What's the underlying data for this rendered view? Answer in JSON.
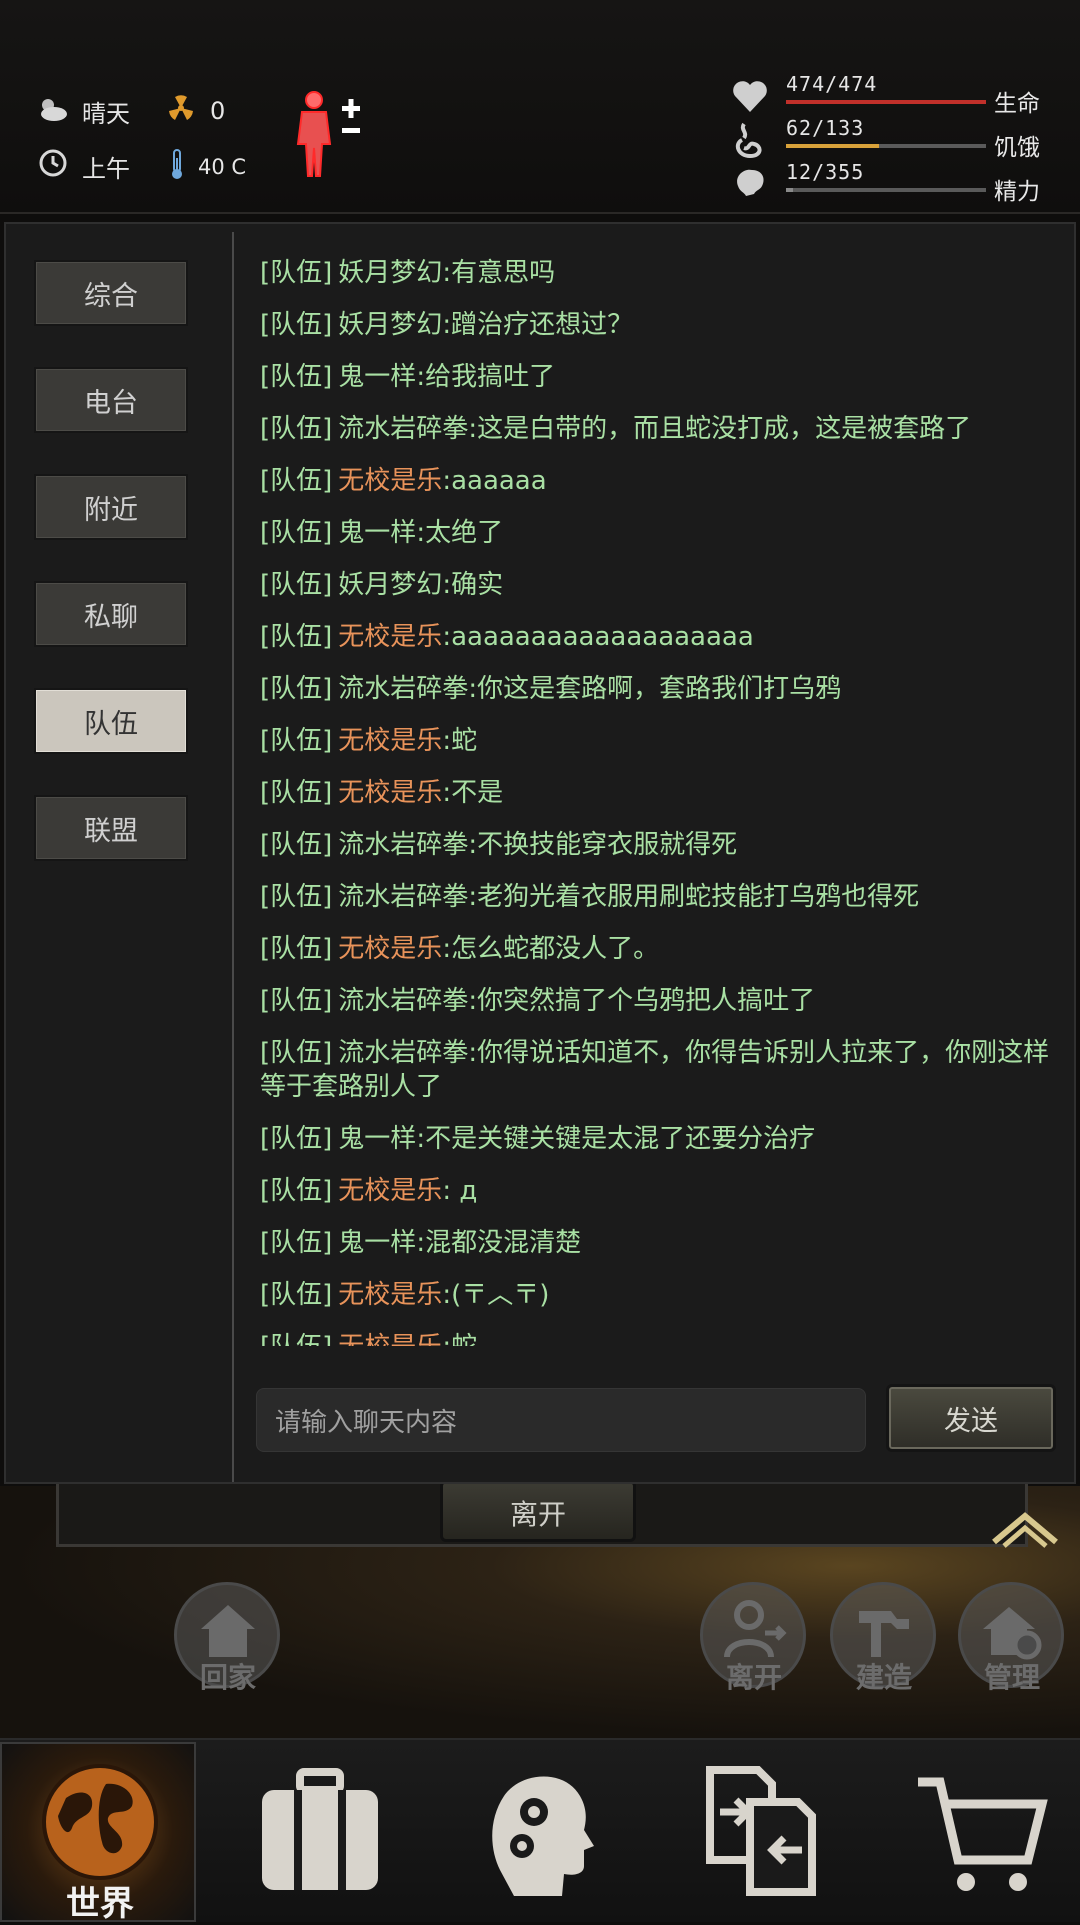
{
  "status": {
    "weather": "晴天",
    "radiation": "0",
    "time_of_day": "上午",
    "temperature": "40 C"
  },
  "bars": {
    "life": {
      "value": "474/474",
      "label": "生命",
      "fraction": 1.0,
      "color": "#c0302a"
    },
    "hunger": {
      "value": "62/133",
      "label": "饥饿",
      "fraction": 0.466,
      "color": "#d9a23a"
    },
    "energy": {
      "value": "12/355",
      "label": "精力",
      "fraction": 0.034,
      "color": "#8a8a8a"
    }
  },
  "channels": [
    {
      "label": "综合",
      "active": false
    },
    {
      "label": "电台",
      "active": false
    },
    {
      "label": "附近",
      "active": false
    },
    {
      "label": "私聊",
      "active": false
    },
    {
      "label": "队伍",
      "active": true
    },
    {
      "label": "联盟",
      "active": false
    }
  ],
  "messages": [
    {
      "channel": "[队伍]",
      "sender": "妖月梦幻",
      "text": ":有意思吗",
      "self": false
    },
    {
      "channel": "[队伍]",
      "sender": "妖月梦幻",
      "text": ":蹭治疗还想过？",
      "self": false
    },
    {
      "channel": "[队伍]",
      "sender": "鬼一样",
      "text": ":给我搞吐了",
      "self": false
    },
    {
      "channel": "[队伍]",
      "sender": "流水岩碎拳",
      "text": ":这是白带的，而且蛇没打成，这是被套路了",
      "self": false
    },
    {
      "channel": "[队伍]",
      "sender": "无校是乐",
      "text": ":aaaaaa",
      "self": true
    },
    {
      "channel": "[队伍]",
      "sender": "鬼一样",
      "text": ":太绝了",
      "self": false
    },
    {
      "channel": "[队伍]",
      "sender": "妖月梦幻",
      "text": ":确实",
      "self": false
    },
    {
      "channel": "[队伍]",
      "sender": "无校是乐",
      "text": ":aaaaaaaaaaaaaaaaaaa",
      "self": true
    },
    {
      "channel": "[队伍]",
      "sender": "流水岩碎拳",
      "text": ":你这是套路啊，套路我们打乌鸦",
      "self": false
    },
    {
      "channel": "[队伍]",
      "sender": "无校是乐",
      "text": ":蛇",
      "self": true
    },
    {
      "channel": "[队伍]",
      "sender": "无校是乐",
      "text": ":不是",
      "self": true
    },
    {
      "channel": "[队伍]",
      "sender": "流水岩碎拳",
      "text": ":不换技能穿衣服就得死",
      "self": false
    },
    {
      "channel": "[队伍]",
      "sender": "流水岩碎拳",
      "text": ":老狗光着衣服用刷蛇技能打乌鸦也得死",
      "self": false
    },
    {
      "channel": "[队伍]",
      "sender": "无校是乐",
      "text": ":怎么蛇都没人了。",
      "self": true
    },
    {
      "channel": "[队伍]",
      "sender": "流水岩碎拳",
      "text": ":你突然搞了个乌鸦把人搞吐了",
      "self": false
    },
    {
      "channel": "[队伍]",
      "sender": "流水岩碎拳",
      "text": ":你得说话知道不，你得告诉别人拉来了，你刚这样等于套路别人了",
      "self": false
    },
    {
      "channel": "[队伍]",
      "sender": "鬼一样",
      "text": ":不是关键关键是太混了还要分治疗",
      "self": false
    },
    {
      "channel": "[队伍]",
      "sender": "无校是乐",
      "text": ":  д",
      "self": true
    },
    {
      "channel": "[队伍]",
      "sender": "鬼一样",
      "text": ":混都没混清楚",
      "self": false
    },
    {
      "channel": "[队伍]",
      "sender": "无校是乐",
      "text": ":(〒︿〒)",
      "self": true
    },
    {
      "channel": "[队伍]",
      "sender": "无校是乐",
      "text": ":蛇",
      "self": true
    }
  ],
  "input": {
    "placeholder": "请输入聊天内容",
    "send_label": "发送"
  },
  "scene": {
    "leave_button": "离开",
    "home_label": "回家",
    "leave_label": "离开",
    "build_label": "建造",
    "manage_label": "管理"
  },
  "nav": {
    "world_label": "世界"
  },
  "icons": {
    "weather": "partly-cloudy-icon",
    "radiation": "radiation-icon",
    "clock": "clock-icon",
    "thermometer": "thermometer-icon",
    "body": "body-status-icon",
    "life": "heart-icon",
    "hunger": "stomach-icon",
    "energy": "brain-icon"
  }
}
